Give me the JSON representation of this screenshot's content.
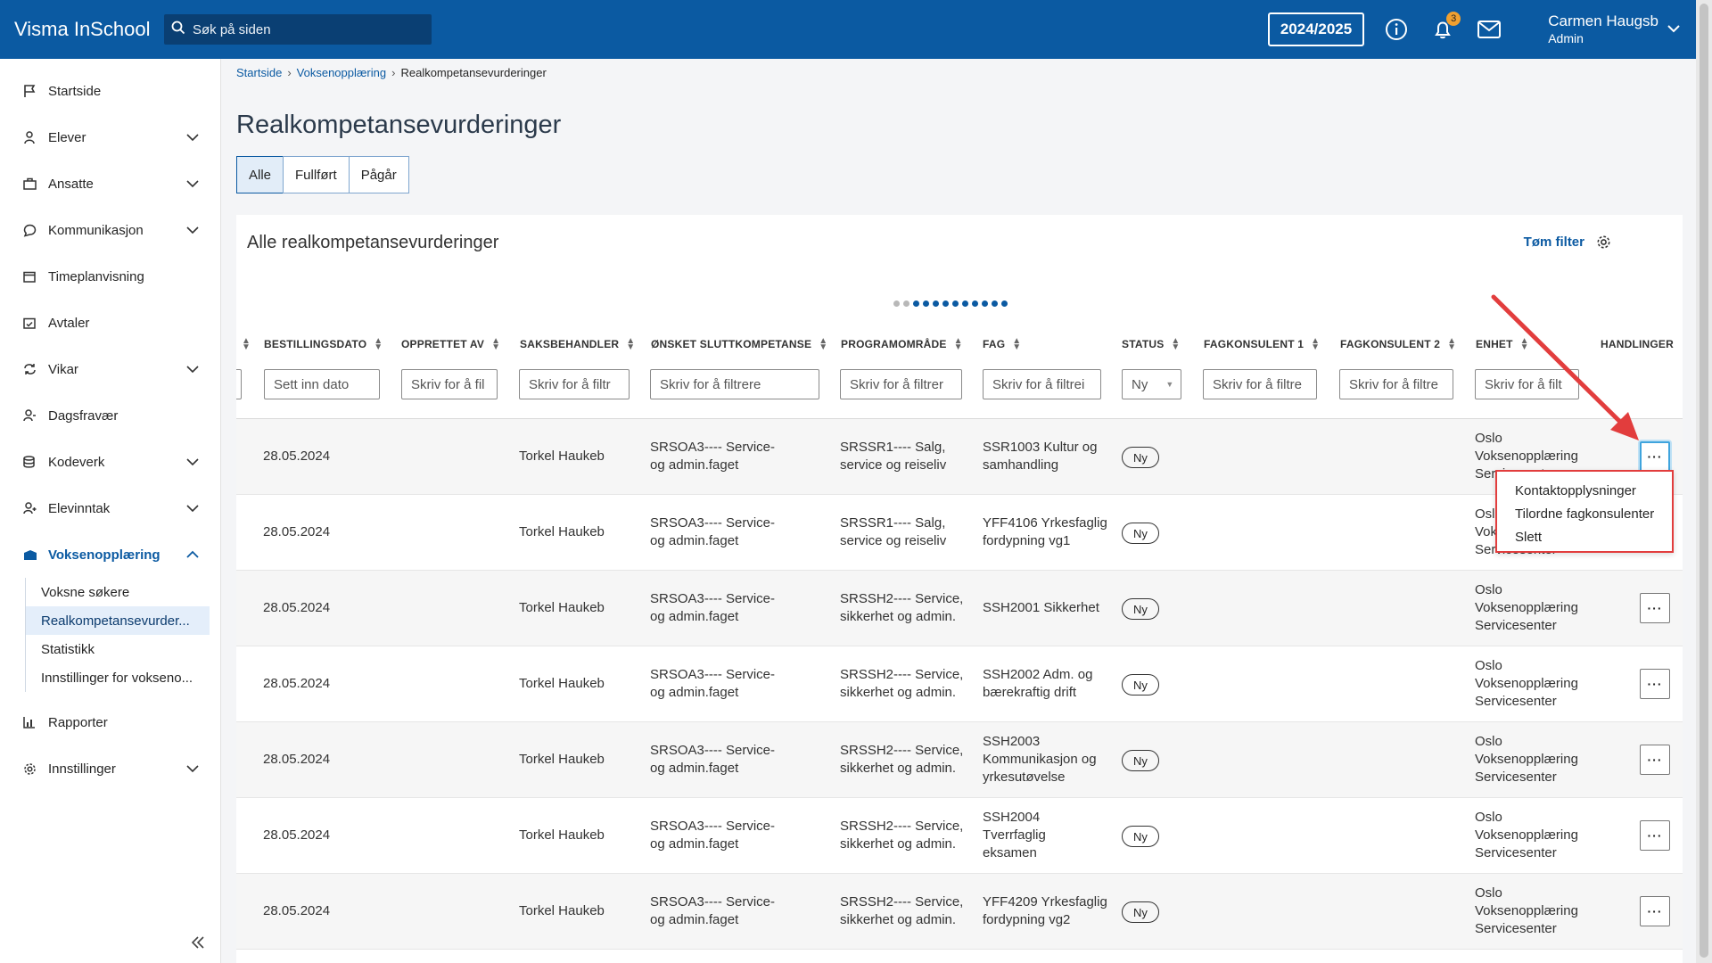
{
  "app": {
    "title": "Visma InSchool"
  },
  "search": {
    "placeholder": "Søk på siden"
  },
  "header": {
    "year": "2024/2025",
    "notifications_count": "3",
    "user_name": "Carmen Haugsb",
    "user_role": "Admin"
  },
  "sidebar": {
    "items": [
      {
        "label": "Startside",
        "icon": "flag-icon",
        "expandable": false
      },
      {
        "label": "Elever",
        "icon": "student-icon",
        "expandable": true
      },
      {
        "label": "Ansatte",
        "icon": "briefcase-icon",
        "expandable": true
      },
      {
        "label": "Kommunikasjon",
        "icon": "chat-icon",
        "expandable": true
      },
      {
        "label": "Timeplanvisning",
        "icon": "calendar-icon",
        "expandable": false
      },
      {
        "label": "Avtaler",
        "icon": "calendar-check-icon",
        "expandable": false
      },
      {
        "label": "Vikar",
        "icon": "swap-icon",
        "expandable": true
      },
      {
        "label": "Dagsfravær",
        "icon": "user-absence-icon",
        "expandable": false
      },
      {
        "label": "Kodeverk",
        "icon": "database-icon",
        "expandable": true
      },
      {
        "label": "Elevinntak",
        "icon": "user-add-icon",
        "expandable": true
      },
      {
        "label": "Voksenopplæring",
        "icon": "adult-education-icon",
        "expandable": true
      }
    ],
    "sub_items": [
      "Voksne søkere",
      "Realkompetansevurder...",
      "Statistikk",
      "Innstillinger for voksenо..."
    ],
    "bottom_items": [
      {
        "label": "Rapporter",
        "icon": "chart-icon",
        "expandable": false
      },
      {
        "label": "Innstillinger",
        "icon": "gear-icon",
        "expandable": true
      }
    ]
  },
  "breadcrumb": [
    "Startside",
    "Voksenopplæring",
    "Realkompetansevurderinger"
  ],
  "page": {
    "title": "Realkompetansevurderinger"
  },
  "tabs": [
    "Alle",
    "Fullført",
    "Pågår"
  ],
  "card": {
    "title": "Alle realkompetansevurderinger",
    "clear_filter": "Tøm filter"
  },
  "table": {
    "headers": [
      "BESTILLINGSDATO",
      "OPPRETTET AV",
      "SAKSBEHANDLER",
      "ØNSKET SLUTTKOMPETANSE",
      "PROGRAMOMRÅDE",
      "FAG",
      "STATUS",
      "FAGKONSULENT 1",
      "FAGKONSULENT 2",
      "ENHET",
      "HANDLINGER"
    ],
    "filters": [
      "Sett inn dato",
      "Skriv for å fil",
      "Skriv for å filtr",
      "Skriv for å filtrere",
      "Skriv for å filtrer",
      "Skriv for å filtrei",
      "Ny",
      "Skriv for å filtre",
      "Skriv for å filtre",
      "Skriv for å filt"
    ],
    "rows": [
      {
        "date": "28.05.2024",
        "saksbehandler": "Torkel Haukeb",
        "kompetanse": "SRSOA3---- Service- og admin.faget",
        "program": "SRSSR1---- Salg, service og reiseliv",
        "fag": "SSR1003 Kultur og samhandling",
        "status": "Ny",
        "enhet": "Oslo Voksenopplæring Servicesenter"
      },
      {
        "date": "28.05.2024",
        "saksbehandler": "Torkel Haukeb",
        "kompetanse": "SRSOA3---- Service- og admin.faget",
        "program": "SRSSR1---- Salg, service og reiseliv",
        "fag": "YFF4106 Yrkesfaglig fordypning vg1",
        "status": "Ny",
        "enhet": "Oslo Voksenopplæring Servicesenter"
      },
      {
        "date": "28.05.2024",
        "saksbehandler": "Torkel Haukeb",
        "kompetanse": "SRSOA3---- Service- og admin.faget",
        "program": "SRSSH2---- Service, sikkerhet og admin.",
        "fag": "SSH2001 Sikkerhet",
        "status": "Ny",
        "enhet": "Oslo Voksenopplæring Servicesenter"
      },
      {
        "date": "28.05.2024",
        "saksbehandler": "Torkel Haukeb",
        "kompetanse": "SRSOA3---- Service- og admin.faget",
        "program": "SRSSH2---- Service, sikkerhet og admin.",
        "fag": "SSH2002 Adm. og bærekraftig drift",
        "status": "Ny",
        "enhet": "Oslo Voksenopplæring Servicesenter"
      },
      {
        "date": "28.05.2024",
        "saksbehandler": "Torkel Haukeb",
        "kompetanse": "SRSOA3---- Service- og admin.faget",
        "program": "SRSSH2---- Service, sikkerhet og admin.",
        "fag": "SSH2003 Kommunikasjon og yrkesutøvelse",
        "status": "Ny",
        "enhet": "Oslo Voksenopplæring Servicesenter"
      },
      {
        "date": "28.05.2024",
        "saksbehandler": "Torkel Haukeb",
        "kompetanse": "SRSOA3---- Service- og admin.faget",
        "program": "SRSSH2---- Service, sikkerhet og admin.",
        "fag": "SSH2004 Tverrfaglig eksamen",
        "status": "Ny",
        "enhet": "Oslo Voksenopplæring Servicesenter"
      },
      {
        "date": "28.05.2024",
        "saksbehandler": "Torkel Haukeb",
        "kompetanse": "SRSOA3---- Service- og admin.faget",
        "program": "SRSSH2---- Service, sikkerhet og admin.",
        "fag": "YFF4209 Yrkesfaglig fordypning vg2",
        "status": "Ny",
        "enhet": "Oslo Voksenopplæring Servicesenter"
      }
    ]
  },
  "action_menu": [
    "Kontaktopplysninger",
    "Tilordne fagkonsulenter",
    "Slett"
  ],
  "colors": {
    "brand": "#0b5aa2",
    "highlight": "#e23d3d"
  }
}
